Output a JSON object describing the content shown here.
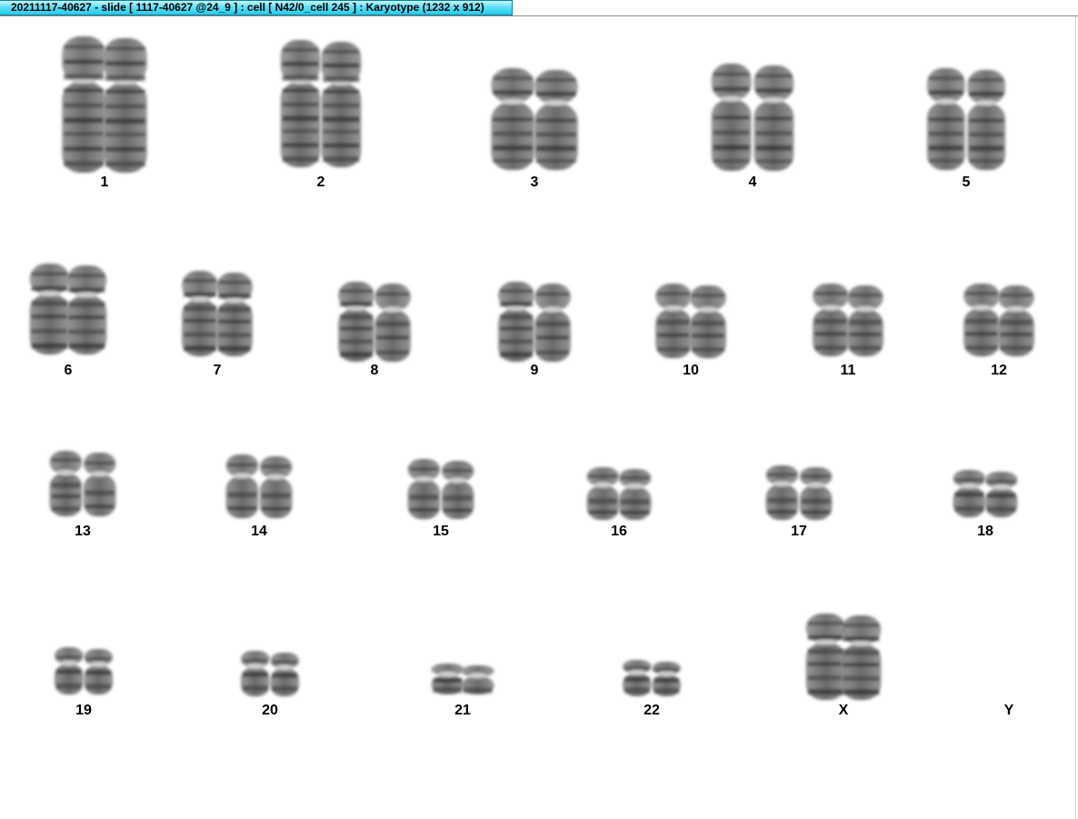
{
  "window": {
    "title": "20211117-40627 - slide [ 1117-40627 @24_9 ] : cell [ N42/0_cell 245 ] : Karyotype  (1232 x 912)"
  },
  "karyotype": {
    "labels": [
      "1",
      "2",
      "3",
      "4",
      "5",
      "6",
      "7",
      "8",
      "9",
      "10",
      "11",
      "12",
      "13",
      "14",
      "15",
      "16",
      "17",
      "18",
      "19",
      "20",
      "21",
      "22",
      "X",
      "Y"
    ],
    "y_present": false
  },
  "colors": {
    "title_bar": "#22cbea",
    "chromosome_dark": "#2e2e2e",
    "chromosome_light": "#9a9a9a"
  }
}
